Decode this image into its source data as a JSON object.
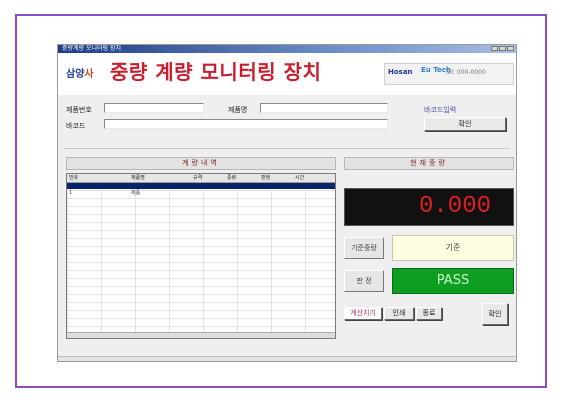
{
  "window": {
    "title": "중량계량 모니터링 장치"
  },
  "header": {
    "logo_prefix": "삼양",
    "logo_suffix": "사",
    "title": "중량 계량 모니터링 장치",
    "brand_name": "Hosan",
    "brand_mid": "Eu Tech",
    "brand_small": "Tel: 000-0000"
  },
  "form": {
    "field1_label": "제품번호",
    "field1_value": "",
    "field2_label": "제품명",
    "field2_value": "",
    "field3_label": "바코드",
    "field3_value": "",
    "top_button": "바코드입력",
    "confirm_button": "확인"
  },
  "panels": {
    "left_title": "계량내역",
    "right_title": "현재중량"
  },
  "table": {
    "columns": [
      "번호",
      "제품명",
      "규격",
      "중량",
      "판정",
      "시간"
    ],
    "rows": [
      [
        "1",
        "제품",
        "",
        "",
        "",
        ""
      ]
    ]
  },
  "reading": {
    "weight": "0.000",
    "label1": "기준중량",
    "value1": "기준",
    "label2": "판 정",
    "value2": "PASS"
  },
  "bottom": {
    "btn1": "계산지기",
    "btn2": "인쇄",
    "btn3": "종료",
    "btn4": "확인"
  },
  "status": {
    "text": ""
  }
}
